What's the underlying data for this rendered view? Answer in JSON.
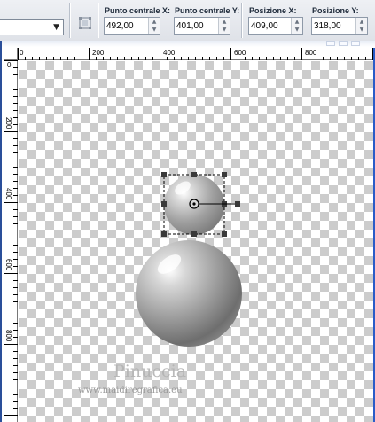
{
  "toolbar": {
    "preset_value": "",
    "fields": [
      {
        "label": "Punto centrale X:",
        "value": "492,00"
      },
      {
        "label": "Punto centrale Y:",
        "value": "401,00"
      },
      {
        "label": "Posizione X:",
        "value": "409,00"
      },
      {
        "label": "Posizione Y:",
        "value": "318,00"
      }
    ]
  },
  "ruler": {
    "top_labels": [
      "0",
      "200",
      "400",
      "600",
      "800"
    ],
    "left_labels": [
      "0",
      "200",
      "400",
      "600",
      "800"
    ]
  },
  "watermark": {
    "title": "Pinuccia",
    "url": "www.maidiregrafica.eu"
  }
}
